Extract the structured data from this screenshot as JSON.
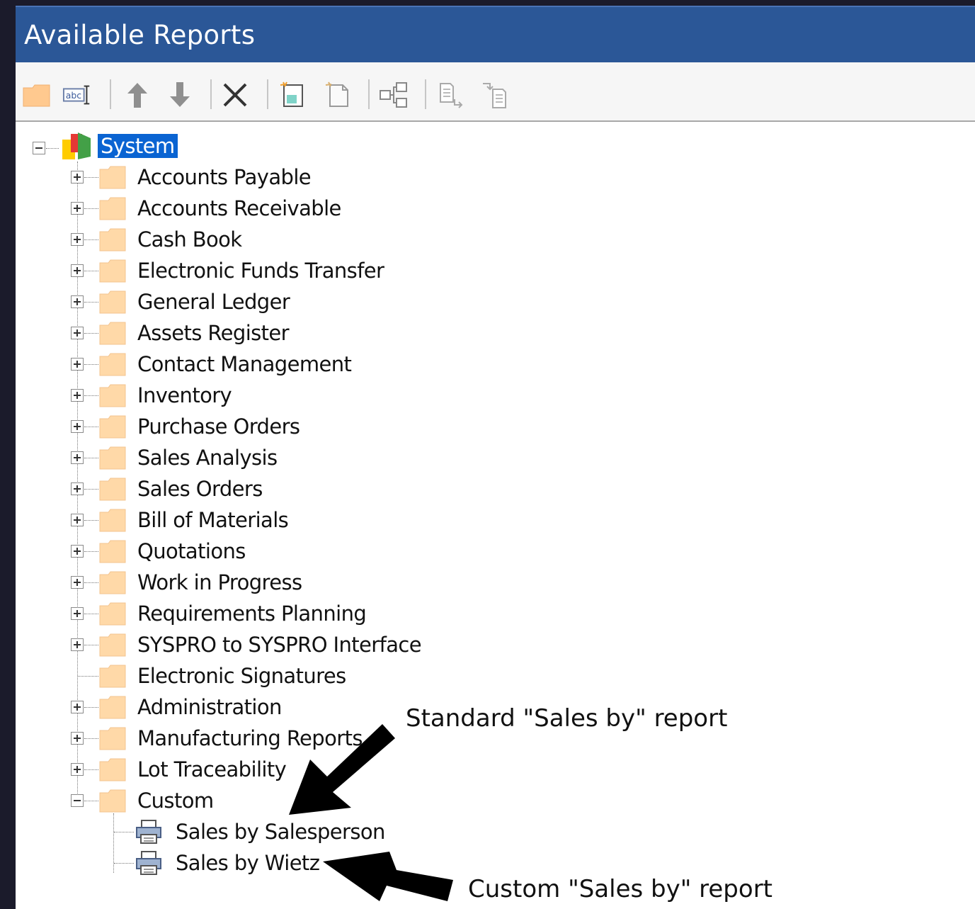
{
  "window": {
    "title": "Available Reports"
  },
  "toolbar": {
    "buttons": [
      {
        "icon": "new-folder-icon"
      },
      {
        "icon": "rename-icon"
      },
      {
        "icon": "move-up-icon"
      },
      {
        "icon": "move-down-icon"
      },
      {
        "icon": "delete-icon"
      },
      {
        "icon": "new-report-icon"
      },
      {
        "icon": "copy-report-icon"
      },
      {
        "icon": "tree-structure-icon"
      },
      {
        "icon": "export-icon"
      },
      {
        "icon": "import-icon"
      }
    ]
  },
  "tree": {
    "root": {
      "label": "System",
      "expanded": true,
      "selected": true
    },
    "folders": [
      {
        "label": "Accounts Payable",
        "expandable": true
      },
      {
        "label": "Accounts Receivable",
        "expandable": true
      },
      {
        "label": "Cash Book",
        "expandable": true
      },
      {
        "label": "Electronic Funds Transfer",
        "expandable": true
      },
      {
        "label": "General Ledger",
        "expandable": true
      },
      {
        "label": "Assets Register",
        "expandable": true
      },
      {
        "label": "Contact Management",
        "expandable": true
      },
      {
        "label": "Inventory",
        "expandable": true
      },
      {
        "label": "Purchase Orders",
        "expandable": true
      },
      {
        "label": "Sales Analysis",
        "expandable": true
      },
      {
        "label": "Sales Orders",
        "expandable": true
      },
      {
        "label": "Bill of Materials",
        "expandable": true
      },
      {
        "label": "Quotations",
        "expandable": true
      },
      {
        "label": "Work in Progress",
        "expandable": true
      },
      {
        "label": "Requirements Planning",
        "expandable": true
      },
      {
        "label": "SYSPRO to SYSPRO Interface",
        "expandable": true
      },
      {
        "label": "Electronic Signatures",
        "expandable": false
      },
      {
        "label": "Administration",
        "expandable": true
      },
      {
        "label": "Manufacturing Reports",
        "expandable": true
      },
      {
        "label": "Lot Traceability",
        "expandable": true
      },
      {
        "label": "Custom",
        "expandable": true,
        "expanded": true
      }
    ],
    "custom_reports": [
      {
        "label": "Sales by Salesperson",
        "icon": "printer-icon"
      },
      {
        "label": "Sales by Wietz",
        "icon": "printer-icon"
      }
    ]
  },
  "annotations": {
    "standard": "Standard \"Sales by\" report",
    "custom": "Custom \"Sales by\" report"
  },
  "colors": {
    "titlebar": "#2b5797",
    "selection": "#0a64d2",
    "folder": "#ffd9a8"
  }
}
